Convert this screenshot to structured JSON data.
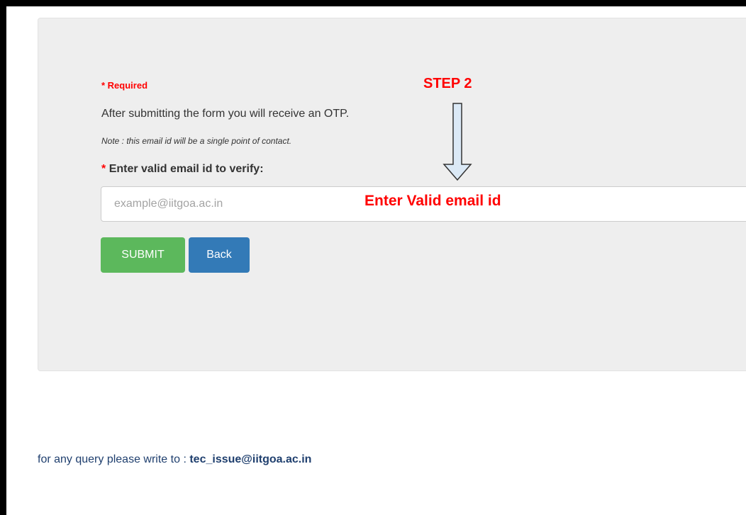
{
  "form": {
    "required_note": "* Required",
    "info_text": "After submitting the form you will receive an OTP.",
    "note_text": "Note : this email id will be a single point of contact.",
    "field_label_star": "*",
    "field_label_text": "Enter valid email id to verify:",
    "email_placeholder": "example@iitgoa.ac.in",
    "email_value": "",
    "submit_label": "SUBMIT",
    "back_label": "Back"
  },
  "annotations": {
    "step_label": "STEP 2",
    "email_hint": "Enter Valid email id",
    "arrow_icon": "down-arrow-icon"
  },
  "footer": {
    "query_text": "for any query please write to :",
    "contact_email": "tec_issue@iitgoa.ac.in"
  },
  "colors": {
    "required": "#ff0000",
    "submit_button": "#5cb85c",
    "back_button": "#337ab7",
    "panel_background": "#eeeeee",
    "footer_text": "#1f3f6e"
  }
}
